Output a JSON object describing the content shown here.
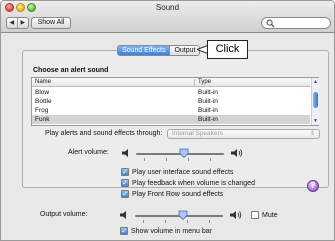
{
  "window": {
    "title": "Sound"
  },
  "toolbar": {
    "back_glyph": "◀",
    "forward_glyph": "▶",
    "show_all_label": "Show All",
    "search_placeholder": "",
    "search_icon": "search-icon"
  },
  "tabs": [
    {
      "label": "Sound Effects",
      "selected": true
    },
    {
      "label": "Output",
      "selected": false
    }
  ],
  "callout": {
    "text": "Click"
  },
  "sound_effects": {
    "choose_label": "Choose an alert sound",
    "table": {
      "columns": [
        "Name",
        "Type"
      ],
      "rows": [
        {
          "name": "Blow",
          "type": "Built-in",
          "selected": false
        },
        {
          "name": "Bottle",
          "type": "Built-in",
          "selected": false
        },
        {
          "name": "Frog",
          "type": "Built-in",
          "selected": false
        },
        {
          "name": "Funk",
          "type": "Built-in",
          "selected": true
        }
      ]
    },
    "through_label": "Play alerts and sound effects through:",
    "through_value": "Internal Speakers",
    "alert_volume_label": "Alert volume:",
    "alert_volume_level": 0.55,
    "options": [
      {
        "label": "Play user interface sound effects",
        "checked": true
      },
      {
        "label": "Play feedback when volume is changed",
        "checked": true
      },
      {
        "label": "Play Front Row sound effects",
        "checked": true
      }
    ],
    "help_glyph": "?"
  },
  "output": {
    "volume_label": "Output volume:",
    "volume_level": 0.55,
    "mute_label": "Mute",
    "mute_checked": false,
    "show_in_menu_bar_label": "Show volume in menu bar",
    "show_in_menu_bar_checked": true
  },
  "colors": {
    "accent": "#3b82dd",
    "callout_border": "#222222"
  }
}
